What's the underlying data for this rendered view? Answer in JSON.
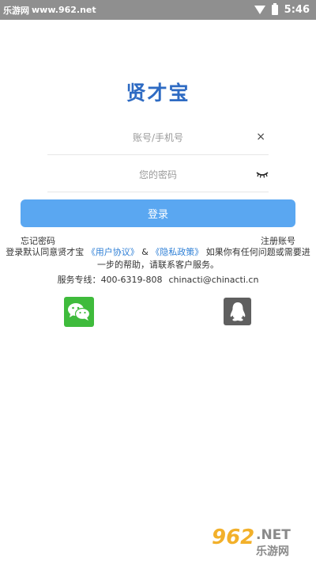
{
  "status_bar": {
    "site_cn": "乐游网",
    "site_url": "www.962.net",
    "time": "5:46"
  },
  "logo_text": "贤才宝",
  "account_field": {
    "placeholder": "账号/手机号",
    "value": ""
  },
  "password_field": {
    "placeholder": "您的密码",
    "value": ""
  },
  "clear_icon_glyph": "×",
  "login_label": "登录",
  "forgot_password": "忘记密码",
  "register_account": "注册账号",
  "agreement": {
    "prefix": "登录默认同意贤才宝",
    "user_agreement": "《用户协议》",
    "amp": "&",
    "privacy_policy": "《隐私政策》",
    "suffix": "如果你有任何问题或需要进一步的帮助，请联系客户服务。"
  },
  "service": {
    "label": "服务专线：",
    "phone": "400-6319-808",
    "email": "chinacti@chinacti.cn"
  },
  "social": {
    "wechat": "wechat-icon",
    "qq": "qq-icon"
  },
  "watermark": {
    "num": "962",
    "net": ".NET",
    "cn": "乐游网"
  },
  "colors": {
    "status_bar": "#8f8f8f",
    "logo": "#2e6bc3",
    "login_button": "#5aa7f1",
    "link": "#2e7fd6",
    "wechat": "#3fbb3c",
    "qq": "#5f5f5f"
  }
}
